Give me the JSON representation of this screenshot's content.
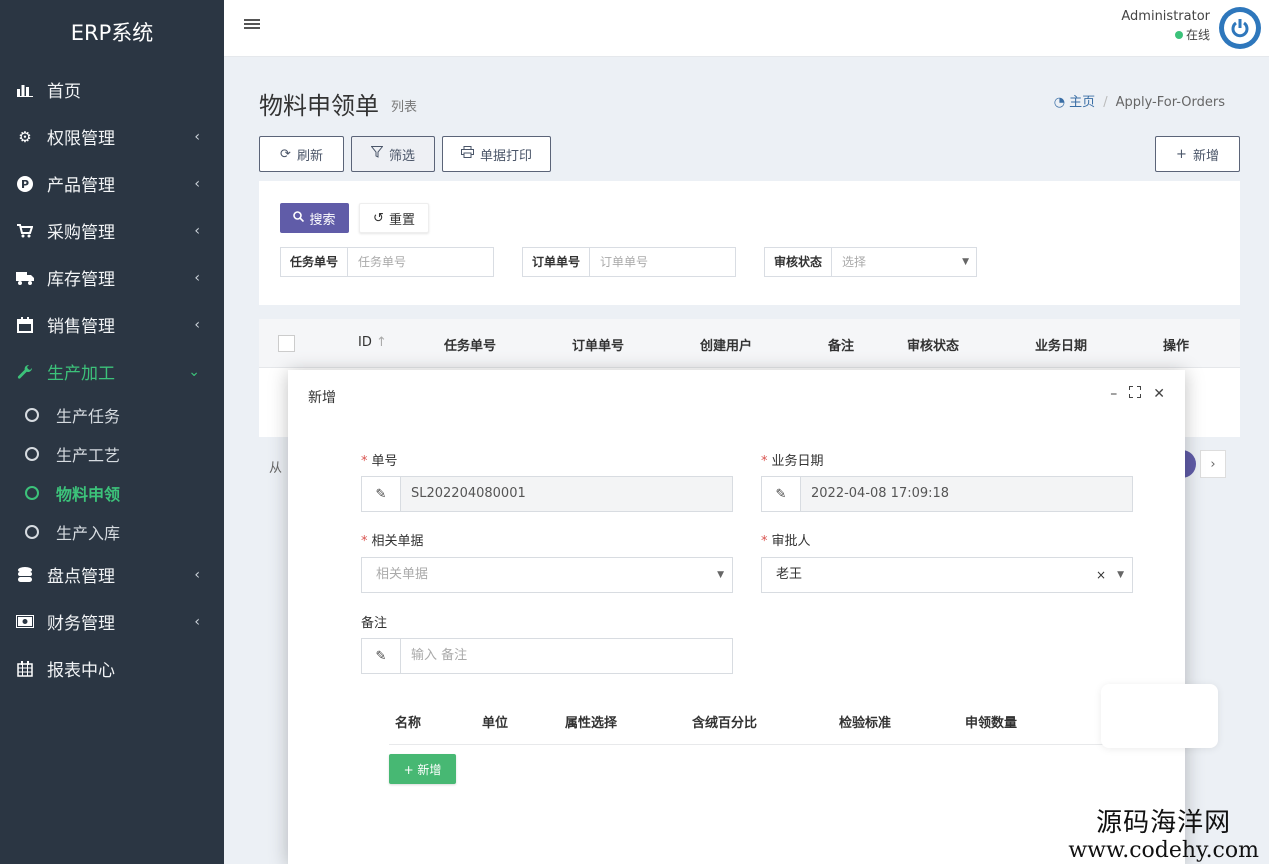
{
  "app": {
    "brand": "ERP系统"
  },
  "sidebar": {
    "items": [
      {
        "label": "首页",
        "icon": "bar-chart-icon"
      },
      {
        "label": "权限管理",
        "icon": "gear-icon"
      },
      {
        "label": "产品管理",
        "icon": "parking-icon"
      },
      {
        "label": "采购管理",
        "icon": "cart-icon"
      },
      {
        "label": "库存管理",
        "icon": "truck-icon"
      },
      {
        "label": "销售管理",
        "icon": "calendar-icon"
      },
      {
        "label": "生产加工",
        "icon": "wrench-icon"
      },
      {
        "label": "盘点管理",
        "icon": "database-icon"
      },
      {
        "label": "财务管理",
        "icon": "money-icon"
      },
      {
        "label": "报表中心",
        "icon": "calendar-grid-icon"
      }
    ],
    "sub_items": [
      "生产任务",
      "生产工艺",
      "物料申领",
      "生产入库"
    ]
  },
  "header": {
    "user_name": "Administrator",
    "user_status": "在线"
  },
  "page": {
    "title": "物料申领单",
    "subtitle": "列表",
    "breadcrumb_home": "主页",
    "breadcrumb_current": "Apply-For-Orders"
  },
  "toolbar": {
    "refresh": "刷新",
    "filter": "筛选",
    "print": "单据打印",
    "add": "新增"
  },
  "search": {
    "search_btn": "搜索",
    "reset_btn": "重置",
    "fields": [
      {
        "label": "任务单号",
        "placeholder": "任务单号"
      },
      {
        "label": "订单单号",
        "placeholder": "订单单号"
      },
      {
        "label": "审核状态",
        "placeholder": "选择"
      }
    ]
  },
  "table": {
    "columns": [
      "ID",
      "任务单号",
      "订单单号",
      "创建用户",
      "备注",
      "审核状态",
      "业务日期",
      "操作"
    ],
    "pager_text": "从"
  },
  "modal": {
    "title": "新增",
    "fields": {
      "number_label": "单号",
      "number_value": "SL202204080001",
      "date_label": "业务日期",
      "date_value": "2022-04-08 17:09:18",
      "related_label": "相关单据",
      "related_placeholder": "相关单据",
      "approver_label": "审批人",
      "approver_value": "老王",
      "remark_label": "备注",
      "remark_placeholder": "输入 备注"
    },
    "detail_columns": [
      "名称",
      "单位",
      "属性选择",
      "含绒百分比",
      "检验标准",
      "申领数量"
    ],
    "add_btn": "+ 新增"
  },
  "watermark": {
    "line1": "源码海洋网",
    "line2": "www.codehy.com"
  },
  "colors": {
    "sidebar_bg": "#2b3643",
    "accent_green": "#3cc27a",
    "primary_purple": "#605ca8",
    "button_green": "#47b873"
  }
}
